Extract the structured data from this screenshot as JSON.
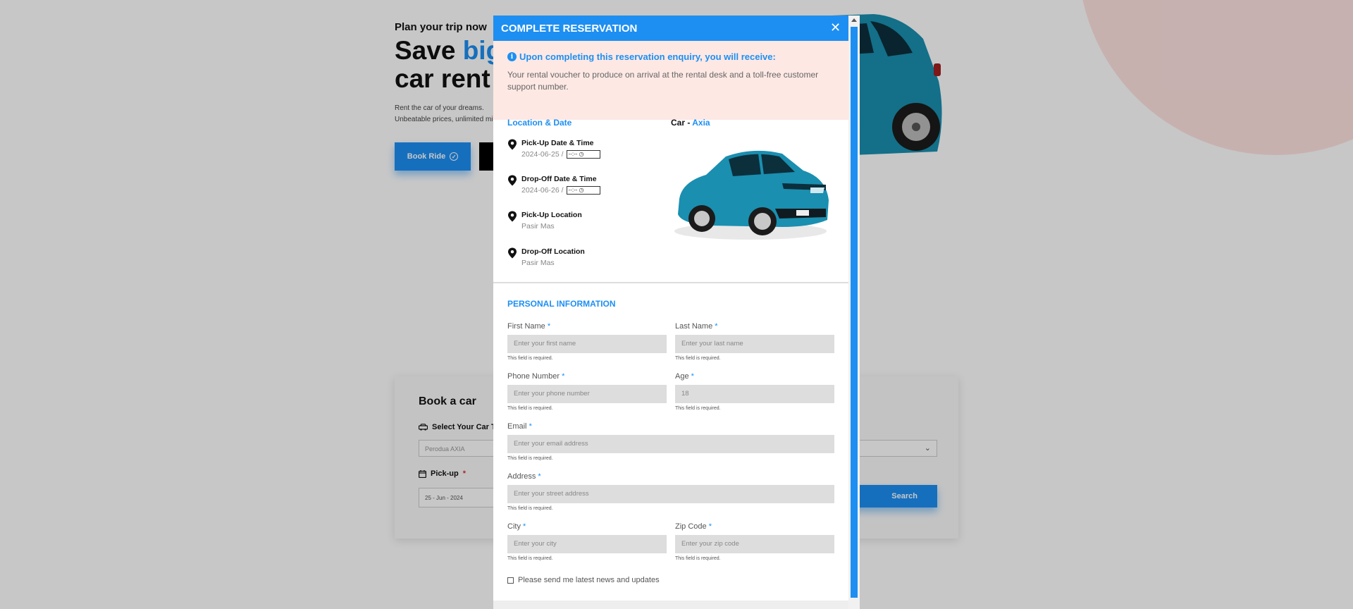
{
  "hero": {
    "tag": "Plan your trip now",
    "title_part1": "Save ",
    "title_accent": "big",
    "title_line2": "car rent",
    "desc": "Rent the car of your dreams. Unbeatable prices, unlimited miles, flexible pick-up options and much more.",
    "book_ride_label": "Book Ride"
  },
  "book_card": {
    "title": "Book a car",
    "select_type_label": "Select Your Car Type",
    "select_type_value": "Perodua AXIA",
    "pickup_label": "Pick-up",
    "pickup_required": "*",
    "pickup_date": "25 - Jun - 2024",
    "search_label": "Search"
  },
  "modal": {
    "title": "COMPLETE RESERVATION",
    "close_symbol": "✕",
    "notice": {
      "title": "Upon completing this reservation enquiry, you will receive:",
      "text": "Your rental voucher to produce on arrival at the rental desk and a toll-free customer support number."
    },
    "location_date": {
      "heading": "Location & Date",
      "items": [
        {
          "label": "Pick-Up Date & Time",
          "date": "2024-06-25 /",
          "time": "--:-- ◷"
        },
        {
          "label": "Drop-Off Date & Time",
          "date": "2024-06-26 /",
          "time": "--:-- ◷"
        },
        {
          "label": "Pick-Up Location",
          "value": "Pasir Mas"
        },
        {
          "label": "Drop-Off Location",
          "value": "Pasir Mas"
        }
      ]
    },
    "car": {
      "heading_prefix": "Car - ",
      "model": "Axia"
    },
    "personal": {
      "heading": "PERSONAL INFORMATION",
      "required_mark": "*",
      "help_text": "This field is required.",
      "fields": {
        "first_name": {
          "label": "First Name",
          "placeholder": "Enter your first name"
        },
        "last_name": {
          "label": "Last Name",
          "placeholder": "Enter your last name"
        },
        "phone": {
          "label": "Phone Number",
          "placeholder": "Enter your phone number"
        },
        "age": {
          "label": "Age",
          "value": "18"
        },
        "email": {
          "label": "Email",
          "placeholder": "Enter your email address"
        },
        "address": {
          "label": "Address",
          "placeholder": "Enter your street address"
        },
        "city": {
          "label": "City",
          "placeholder": "Enter your city"
        },
        "zip": {
          "label": "Zip Code",
          "placeholder": "Enter your zip code"
        }
      },
      "newsletter_label": "Please send me latest news and updates"
    }
  },
  "colors": {
    "accent": "#1d8ff2",
    "notice_bg": "#fde8e4",
    "car_teal": "#1a8fb0"
  }
}
